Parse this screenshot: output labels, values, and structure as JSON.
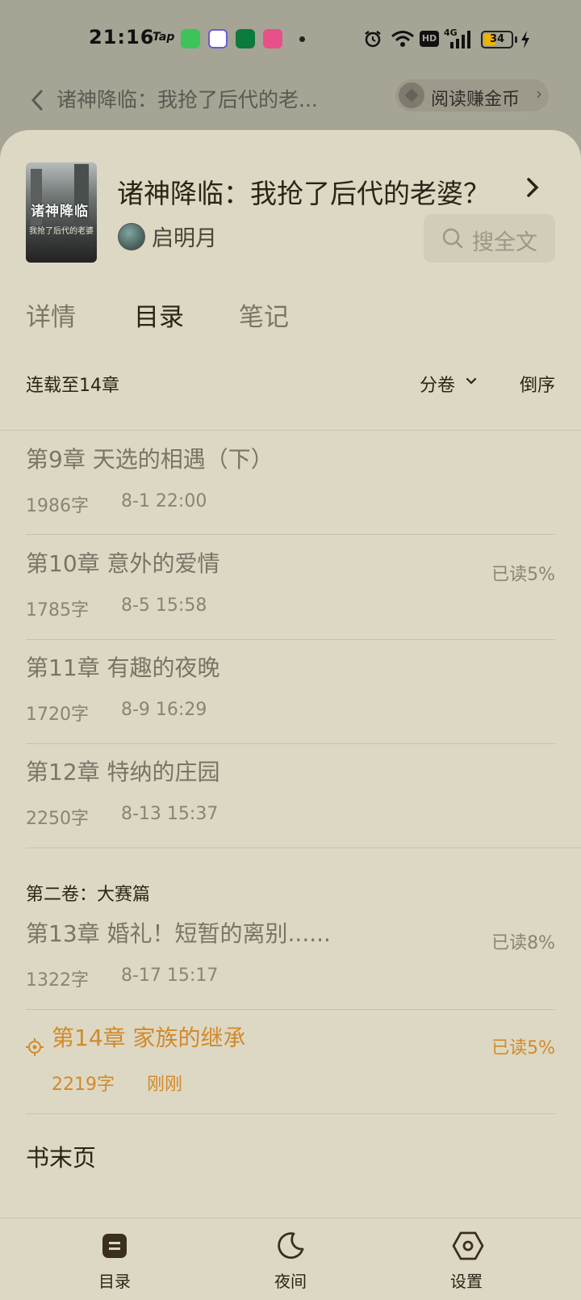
{
  "status_bar": {
    "time": "21:16",
    "tap_label": "Tap",
    "network": "4G",
    "hd_label": "HD",
    "battery": "34",
    "apps": [
      {
        "icon": "android-app-icon",
        "color": "#3ec35a"
      },
      {
        "icon": "nebula-app-icon",
        "color": "#6b5bd6"
      },
      {
        "icon": "oppo-app-icon",
        "color": "#0b7a3b"
      },
      {
        "icon": "pink-app-icon",
        "color": "#e8508a"
      }
    ]
  },
  "reader_header": {
    "title": "诸神降临：我抢了后代的老...",
    "earn_label": "阅读赚金币"
  },
  "book": {
    "cover_title": "诸神降临",
    "cover_subtitle": "我抢了后代的老婆",
    "title": "诸神降临：我抢了后代的老婆？",
    "author": "启明月",
    "search_label": "搜全文"
  },
  "tabs": [
    {
      "label": "详情",
      "active": false
    },
    {
      "label": "目录",
      "active": true
    },
    {
      "label": "笔记",
      "active": false
    }
  ],
  "toc": {
    "status": "连载至14章",
    "split_label": "分卷",
    "order_label": "倒序"
  },
  "chapters": [
    {
      "title": "第9章 天选的相遇（下）",
      "words": "1986字",
      "date": "8-1 22:00",
      "progress": ""
    },
    {
      "title": "第10章 意外的爱情",
      "words": "1785字",
      "date": "8-5 15:58",
      "progress": "已读5%"
    },
    {
      "title": "第11章 有趣的夜晚",
      "words": "1720字",
      "date": "8-9 16:29",
      "progress": ""
    },
    {
      "title": "第12章 特纳的庄园",
      "words": "2250字",
      "date": "8-13 15:37",
      "progress": ""
    }
  ],
  "volume2": {
    "title": "第二卷：大赛篇",
    "chapters": [
      {
        "title": "第13章 婚礼！短暂的离别......",
        "words": "1322字",
        "date": "8-17 15:17",
        "progress": "已读8%"
      },
      {
        "title": "第14章 家族的继承",
        "words": "2219字",
        "date": "刚刚",
        "progress": "已读5%",
        "current": true
      }
    ]
  },
  "end_page": "书末页",
  "bottom_nav": [
    {
      "label": "目录",
      "icon": "toc-icon"
    },
    {
      "label": "夜间",
      "icon": "moon-icon"
    },
    {
      "label": "设置",
      "icon": "settings-icon"
    }
  ],
  "colors": {
    "sheet_bg": "#ddd8c4",
    "accent": "#d28a2a",
    "text_primary": "#2b2417",
    "text_muted": "#7a7466",
    "dim_overlay": "#a6a494"
  }
}
